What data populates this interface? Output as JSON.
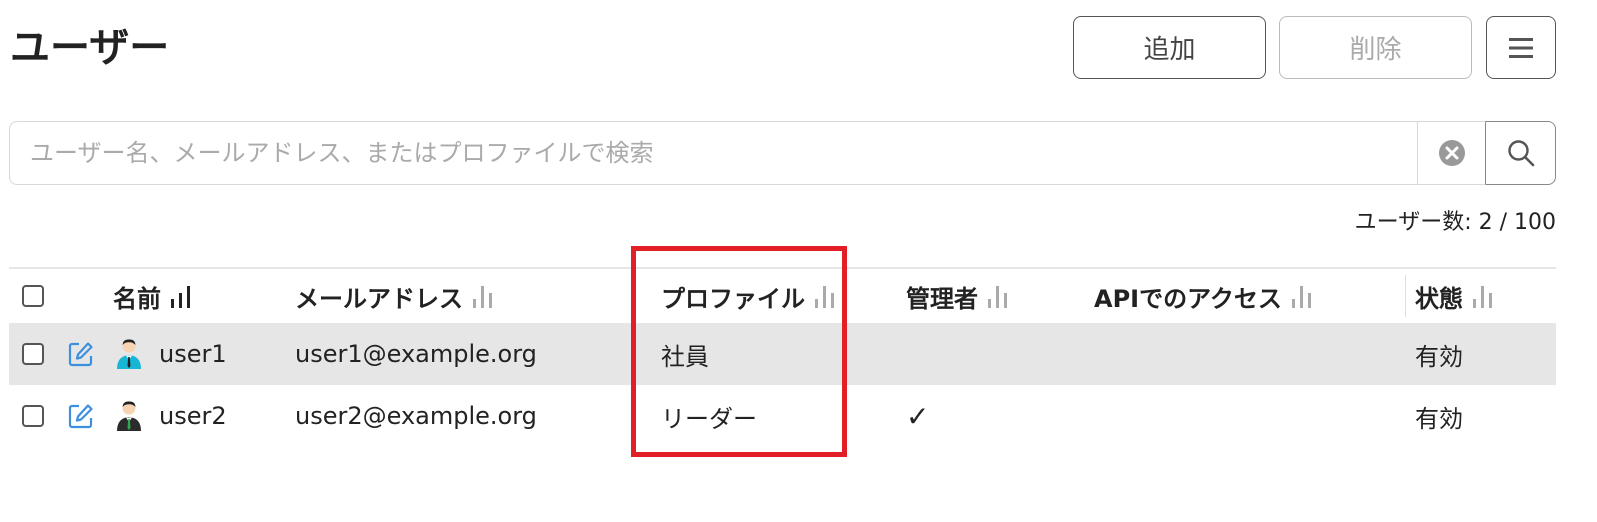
{
  "header": {
    "title": "ユーザー",
    "add_label": "追加",
    "delete_label": "削除"
  },
  "search": {
    "placeholder": "ユーザー名、メールアドレス、またはプロファイルで検索",
    "value": ""
  },
  "user_count": {
    "label": "ユーザー数: 2 / 100"
  },
  "table": {
    "columns": [
      "名前",
      "メールアドレス",
      "プロファイル",
      "管理者",
      "APIでのアクセス",
      "状態"
    ],
    "rows": [
      {
        "name": "user1",
        "email": "user1@example.org",
        "profile": "社員",
        "admin": "",
        "api": "",
        "status": "有効"
      },
      {
        "name": "user2",
        "email": "user2@example.org",
        "profile": "リーダー",
        "admin": "✓",
        "api": "",
        "status": "有効"
      }
    ]
  },
  "colors": {
    "accent_blue": "#3d8fe0",
    "highlight_red": "#e21f26",
    "row_shade": "#e6e6e6"
  },
  "icons": {
    "menu": "hamburger-menu-icon",
    "clear": "clear-circle-icon",
    "search": "magnifier-icon",
    "sort": "sort-bars-icon",
    "edit": "edit-pencil-icon",
    "avatar": "user-avatar-icon"
  }
}
